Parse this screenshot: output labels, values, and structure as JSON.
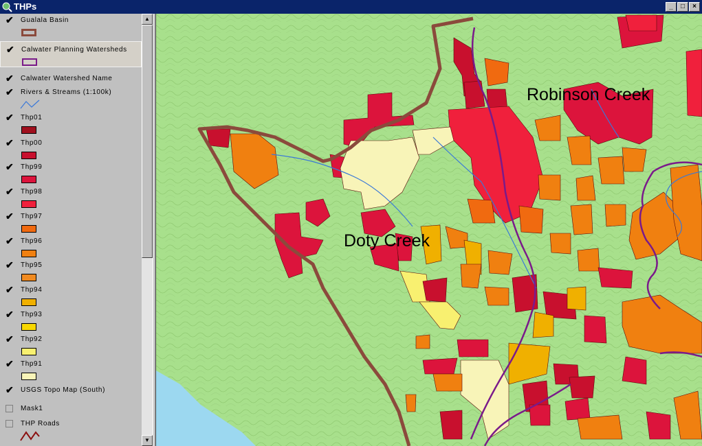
{
  "window": {
    "title": "THPs"
  },
  "window_controls": {
    "minimize": "_",
    "maximize": "□",
    "close": "×"
  },
  "legend": {
    "layers": [
      {
        "name": "Gualala Basin",
        "checked": true,
        "symbol": "outline",
        "color": "#8b4a3c"
      },
      {
        "name": "Calwater Planning Watersheds",
        "checked": true,
        "symbol": "outline",
        "color": "#7a1a8a",
        "selected": true
      },
      {
        "name": "Calwater Watershed Name",
        "checked": true,
        "symbol": "none"
      },
      {
        "name": "Rivers & Streams (1:100k)",
        "checked": true,
        "symbol": "line",
        "color": "#3a78d8"
      },
      {
        "name": "Thp01",
        "checked": true,
        "symbol": "fill",
        "color": "#a0101e"
      },
      {
        "name": "Thp00",
        "checked": true,
        "symbol": "fill",
        "color": "#c8102e"
      },
      {
        "name": "Thp99",
        "checked": true,
        "symbol": "fill",
        "color": "#dc143c"
      },
      {
        "name": "Thp98",
        "checked": true,
        "symbol": "fill",
        "color": "#f0203c"
      },
      {
        "name": "Thp97",
        "checked": true,
        "symbol": "fill",
        "color": "#f06a10"
      },
      {
        "name": "Thp96",
        "checked": true,
        "symbol": "fill",
        "color": "#f08010"
      },
      {
        "name": "Thp95",
        "checked": true,
        "symbol": "fill",
        "color": "#f08a20"
      },
      {
        "name": "Thp94",
        "checked": true,
        "symbol": "fill",
        "color": "#f0b000"
      },
      {
        "name": "Thp93",
        "checked": true,
        "symbol": "fill",
        "color": "#f8d800"
      },
      {
        "name": "Thp92",
        "checked": true,
        "symbol": "fill",
        "color": "#f8f070"
      },
      {
        "name": "Thp91",
        "checked": true,
        "symbol": "fill",
        "color": "#f8f4b8"
      },
      {
        "name": "USGS Topo Map (South)",
        "checked": true,
        "symbol": "none"
      },
      {
        "name": "Mask1",
        "checked": false,
        "symbol": "none"
      },
      {
        "name": "THP Roads",
        "checked": false,
        "symbol": "road",
        "color": "#8b1010"
      }
    ]
  },
  "map": {
    "labels": {
      "robinson": "Robinson Creek",
      "doty": "Doty Creek"
    },
    "colors": {
      "terrain": "#a8e08c",
      "water": "#9cd8f0",
      "basin": "#8b4a3c",
      "watershed": "#7a1a8a",
      "stream": "#3a78d8"
    }
  }
}
